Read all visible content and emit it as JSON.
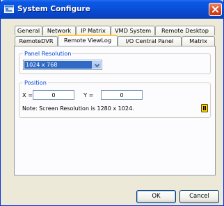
{
  "window": {
    "title": "System Configure",
    "icon": "app-window-icon",
    "close_icon": "close-icon",
    "colors": {
      "titlebar": "#0a50d9",
      "close": "#d9451c",
      "group_label": "#0046d5",
      "selection": "#316ac5"
    }
  },
  "tabs": {
    "row_back": [
      "General",
      "Network",
      "IP Matrix",
      "VMD System",
      "Remote Desktop"
    ],
    "row_front": [
      "RemoteDVR",
      "Remote ViewLog",
      "I/O Central Panel",
      "Matrix"
    ],
    "active": "Remote ViewLog"
  },
  "panel_resolution": {
    "label": "Panel Resolution",
    "selected": "1024 x 768"
  },
  "position": {
    "label": "Position",
    "x_label": "X =",
    "x_value": "0",
    "y_label": "Y =",
    "y_value": "0",
    "note": "Note: Screen Resolution is 1280 x 1024.",
    "hint_icon": "help-icon"
  },
  "buttons": {
    "ok": "OK",
    "cancel": "Cancel"
  }
}
